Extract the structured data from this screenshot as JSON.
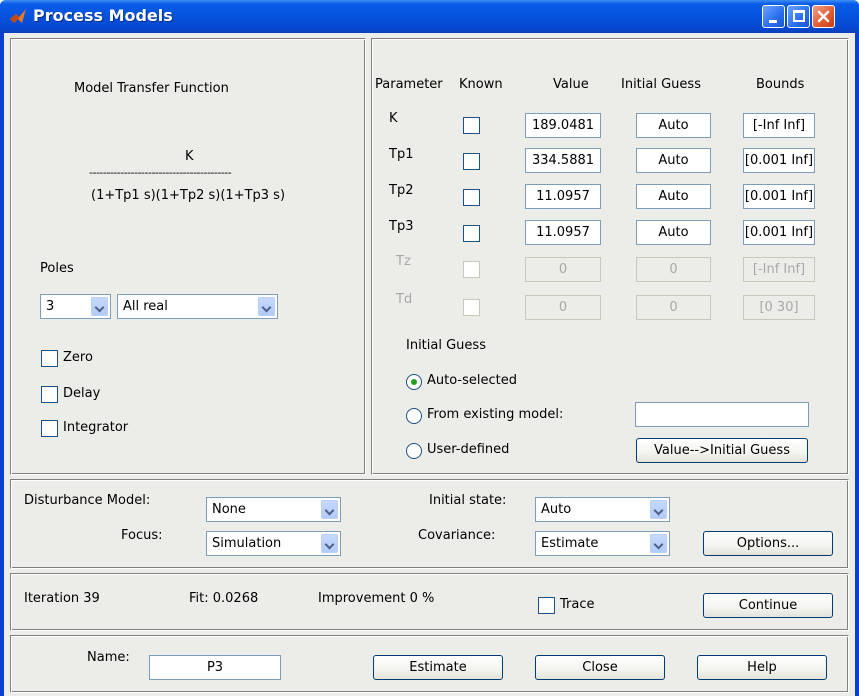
{
  "window": {
    "title": "Process Models"
  },
  "tf": {
    "heading": "Model Transfer Function",
    "numerator": "K",
    "divider": "-----------------------------------------",
    "denominator": "(1+Tp1 s)(1+Tp2 s)(1+Tp3 s)"
  },
  "poles": {
    "label": "Poles",
    "count": "3",
    "type": "All real"
  },
  "options": {
    "zero": "Zero",
    "delay": "Delay",
    "integrator": "Integrator"
  },
  "params": {
    "headers": {
      "parameter": "Parameter",
      "known": "Known",
      "value": "Value",
      "initial_guess": "Initial Guess",
      "bounds": "Bounds"
    },
    "rows": [
      {
        "name": "K",
        "value": "189.0481",
        "guess": "Auto",
        "bounds": "[-Inf Inf]",
        "enabled": true
      },
      {
        "name": "Tp1",
        "value": "334.5881",
        "guess": "Auto",
        "bounds": "[0.001 Inf]",
        "enabled": true
      },
      {
        "name": "Tp2",
        "value": "11.0957",
        "guess": "Auto",
        "bounds": "[0.001 Inf]",
        "enabled": true
      },
      {
        "name": "Tp3",
        "value": "11.0957",
        "guess": "Auto",
        "bounds": "[0.001 Inf]",
        "enabled": true
      },
      {
        "name": "Tz",
        "value": "0",
        "guess": "0",
        "bounds": "[-Inf Inf]",
        "enabled": false
      },
      {
        "name": "Td",
        "value": "0",
        "guess": "0",
        "bounds": "[0 30]",
        "enabled": false
      }
    ]
  },
  "initial_guess": {
    "label": "Initial Guess",
    "auto": "Auto-selected",
    "existing": "From existing model:",
    "existing_value": "",
    "user": "User-defined",
    "value_button": "Value-->Initial Guess"
  },
  "disturbance": {
    "label": "Disturbance Model:",
    "value": "None",
    "focus_label": "Focus:",
    "focus_value": "Simulation",
    "initial_state_label": "Initial state:",
    "initial_state_value": "Auto",
    "covariance_label": "Covariance:",
    "covariance_value": "Estimate",
    "options_button": "Options..."
  },
  "status": {
    "iteration": "Iteration 39",
    "fit": "Fit: 0.0268",
    "improvement": "Improvement 0 %",
    "trace": "Trace",
    "continue_button": "Continue"
  },
  "footer": {
    "name_label": "Name:",
    "name_value": "P3",
    "estimate_button": "Estimate",
    "close_button": "Close",
    "help_button": "Help"
  },
  "colors": {
    "title_bar": "#0552dd",
    "panel_bg": "#ecece9",
    "radio_selected": "#21a121"
  }
}
